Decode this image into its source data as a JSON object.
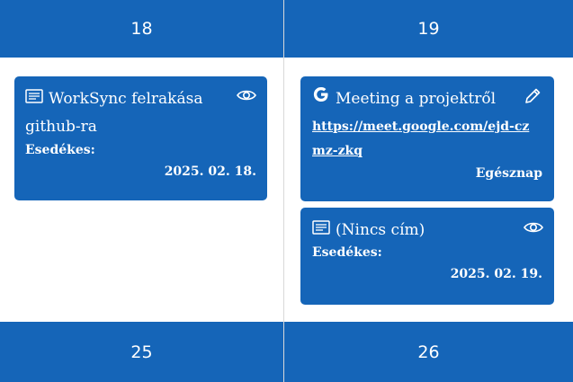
{
  "days": {
    "d18": "18",
    "d19": "19",
    "d25": "25",
    "d26": "26"
  },
  "events": [
    {
      "title": "WorkSync felrakása github-ra",
      "type_icon": "notes-icon",
      "action_icon": "eye-icon",
      "due_label": "Esedékes:",
      "date": "2025. 02. 18."
    },
    {
      "title": "Meeting a projektről",
      "type_icon": "google-icon",
      "action_icon": "pencil-icon",
      "link": "https://meet.google.com/ejd-czmz-zkq",
      "allday_label": "Egésznap"
    },
    {
      "title": "(Nincs cím)",
      "type_icon": "notes-icon",
      "action_icon": "eye-icon",
      "due_label": "Esedékes:",
      "date": "2025. 02. 19."
    }
  ],
  "colors": {
    "primary": "#1565b8",
    "divider": "#d9d9d9"
  }
}
